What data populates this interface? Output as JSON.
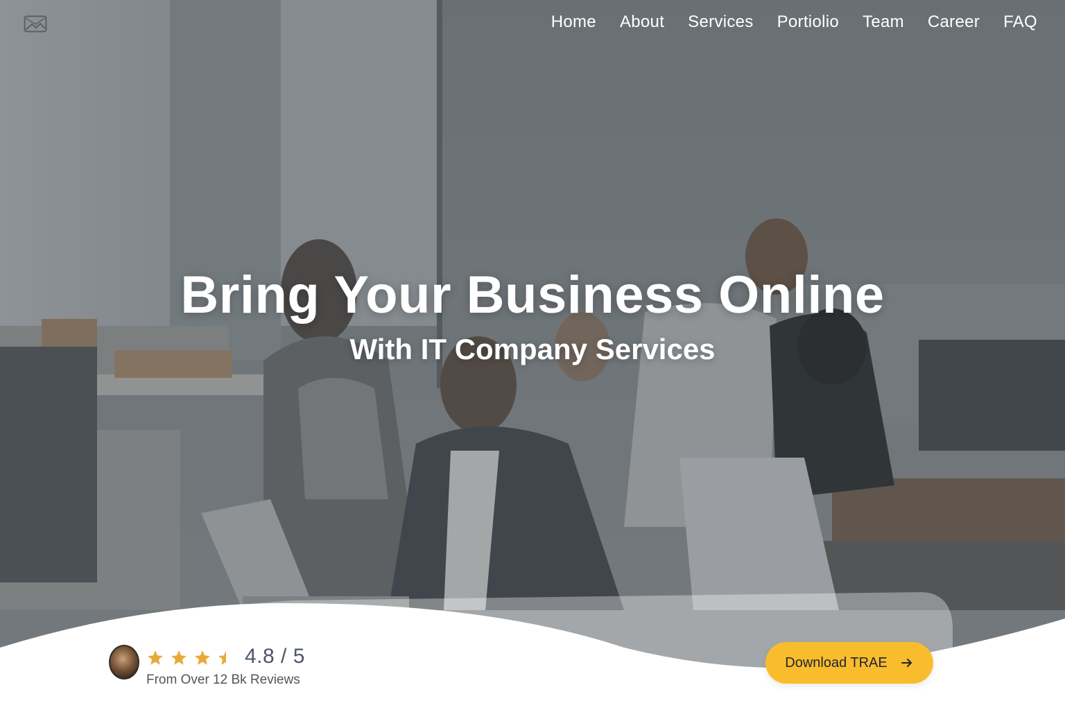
{
  "nav": {
    "items": [
      {
        "label": "Home"
      },
      {
        "label": "About"
      },
      {
        "label": "Services"
      },
      {
        "label": "Portiolio"
      },
      {
        "label": "Team"
      },
      {
        "label": "Career"
      },
      {
        "label": "FAQ"
      }
    ]
  },
  "logo": {
    "icon": "image-placeholder-icon"
  },
  "hero": {
    "title": "Bring Your Business Online",
    "subtitle": "With IT Company Services"
  },
  "rating": {
    "stars": 4.5,
    "score": "4.8 / 5",
    "reviews_text": "From Over 12 Bk Reviews"
  },
  "cta": {
    "label": "Download TRAE",
    "icon": "arrow-right-icon"
  },
  "colors": {
    "accent": "#f9bc2c",
    "star": "#e9a93a",
    "text_dark": "#1f2430",
    "score_text": "#4b5566"
  }
}
